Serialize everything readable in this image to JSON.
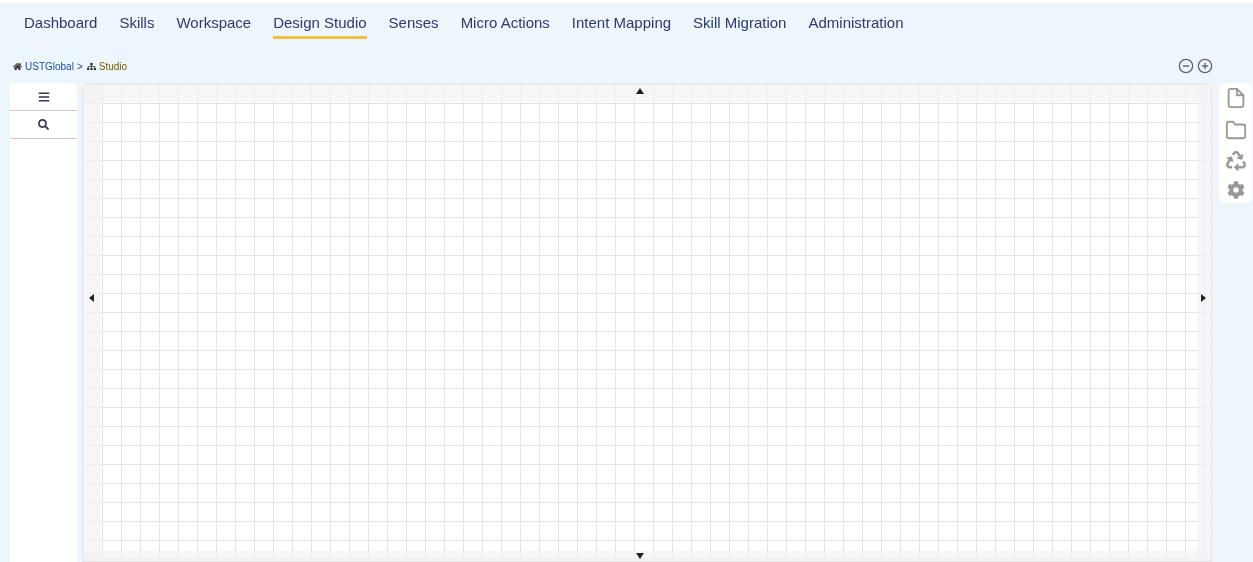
{
  "nav_tabs": [
    {
      "label": "Dashboard",
      "selected": false
    },
    {
      "label": "Skills",
      "selected": false
    },
    {
      "label": "Workspace",
      "selected": false
    },
    {
      "label": "Design Studio",
      "selected": true
    },
    {
      "label": "Senses",
      "selected": false
    },
    {
      "label": "Micro Actions",
      "selected": false
    },
    {
      "label": "Intent Mapping",
      "selected": false
    },
    {
      "label": "Skill Migration",
      "selected": false
    },
    {
      "label": "Administration",
      "selected": false
    }
  ],
  "breadcrumb": [
    {
      "label": "USTGlobal",
      "separator": ">"
    },
    {
      "label": "Studio"
    }
  ]
}
